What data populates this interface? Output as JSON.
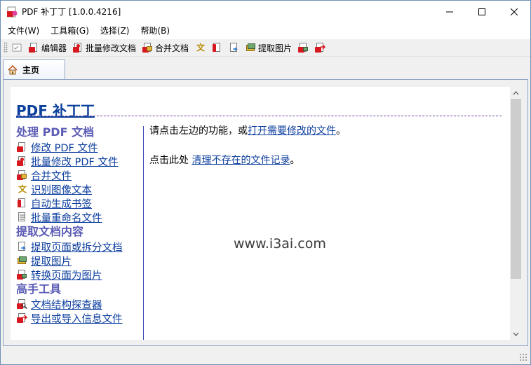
{
  "window": {
    "title": "PDF 补丁丁 [1.0.0.4216]"
  },
  "menu": [
    "文件(W)",
    "工具箱(G)",
    "选择(Z)",
    "帮助(B)"
  ],
  "toolbar": {
    "editor": "编辑器",
    "batch_modify": "批量修改文档",
    "merge": "合并文档",
    "extract_images": "提取图片"
  },
  "tab": {
    "label": "主页"
  },
  "page": {
    "title": "PDF 补丁丁",
    "sections": [
      {
        "title": "处理 PDF 文档",
        "links": [
          {
            "label": "修改 PDF 文件",
            "icon": "pdf-edit-icon"
          },
          {
            "label": "批量修改 PDF 文件",
            "icon": "pdf-batch-icon"
          },
          {
            "label": "合并文件",
            "icon": "merge-icon"
          },
          {
            "label": "识别图像文本",
            "icon": "ocr-icon"
          },
          {
            "label": "自动生成书签",
            "icon": "bookmark-icon"
          },
          {
            "label": "批量重命名文件",
            "icon": "rename-icon"
          }
        ]
      },
      {
        "title": "提取文档内容",
        "links": [
          {
            "label": "提取页面或拆分文档",
            "icon": "extract-pages-icon"
          },
          {
            "label": "提取图片",
            "icon": "extract-images-icon"
          },
          {
            "label": "转换页面为图片",
            "icon": "render-pages-icon"
          }
        ]
      },
      {
        "title": "高手工具",
        "links": [
          {
            "label": "文档结构探查器",
            "icon": "inspector-icon"
          },
          {
            "label": "导出或导入信息文件",
            "icon": "export-import-icon"
          }
        ]
      }
    ],
    "line1_prefix": "请点击左边的功能，或",
    "line1_link": "打开需要修改的文件",
    "line1_suffix": "。",
    "line2_prefix": "点击此处 ",
    "line2_link": "清理不存在的文件记录",
    "line2_suffix": "。",
    "watermark": "www.i3ai.com"
  },
  "colors": {
    "link": "#0b3d9e",
    "section_title": "#5b5bb5",
    "pdf_red": "#d7191f"
  }
}
